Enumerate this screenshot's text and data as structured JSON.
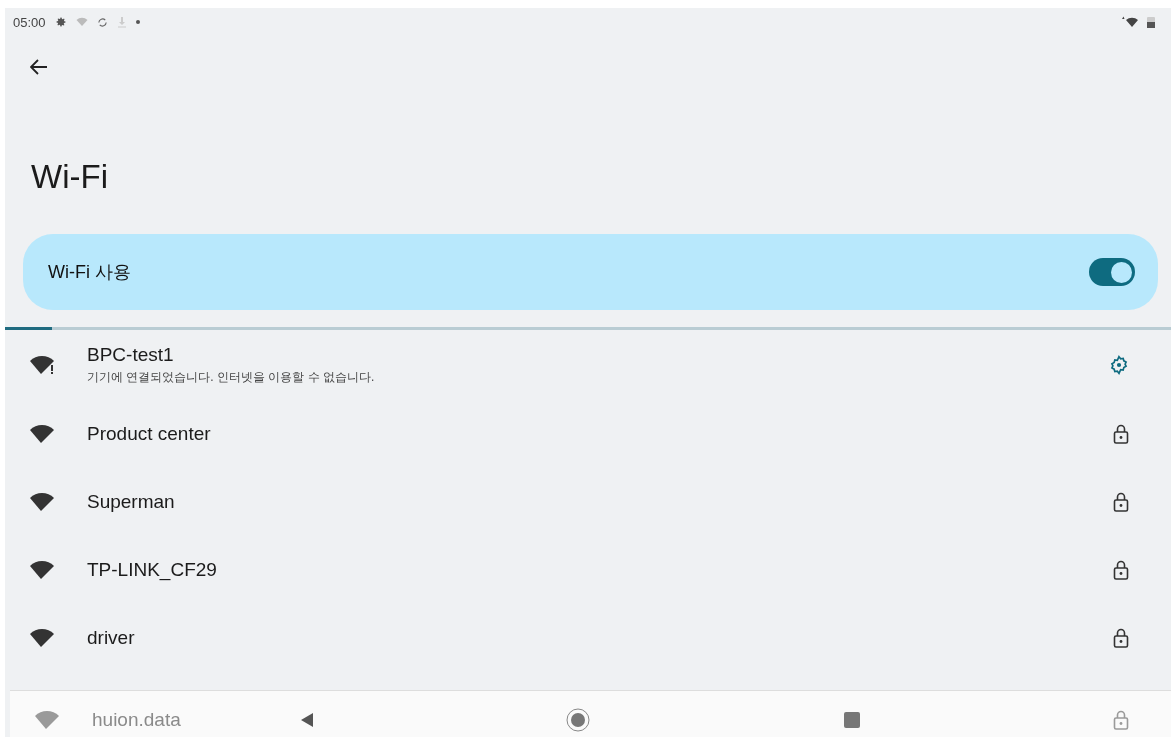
{
  "status_bar": {
    "time": "05:00"
  },
  "title": "Wi-Fi",
  "wifi_toggle": {
    "label": "Wi-Fi 사용",
    "on": true
  },
  "scan_progress": {
    "level": 0.04
  },
  "networks": [
    {
      "kind": "connected",
      "name": "BPC-test1",
      "summary": "기기에 연결되었습니다. 인터넷을 이용할 수 없습니다.",
      "faded": false
    },
    {
      "kind": "secured",
      "name": "Product center",
      "faded": false
    },
    {
      "kind": "secured",
      "name": "Superman",
      "faded": false
    },
    {
      "kind": "secured",
      "name": "TP-LINK_CF29",
      "faded": false
    },
    {
      "kind": "secured",
      "name": "driver",
      "faded": false
    },
    {
      "kind": "secured",
      "name": "huion.data",
      "faded": true
    }
  ]
}
